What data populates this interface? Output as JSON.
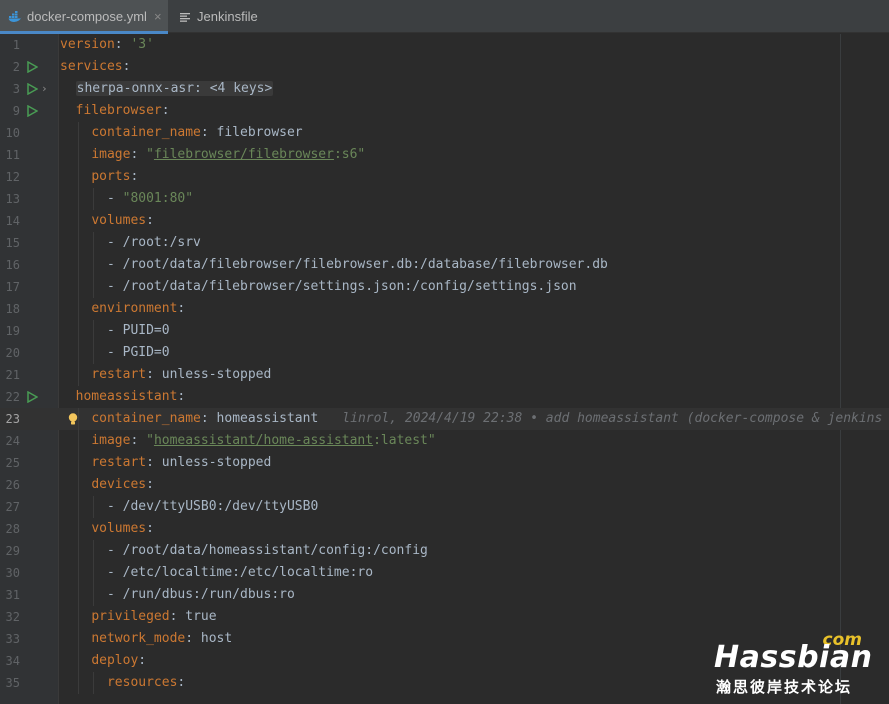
{
  "tabs": [
    {
      "label": "docker-compose.yml",
      "icon": "docker-icon",
      "active": true,
      "close": "×"
    },
    {
      "label": "Jenkinsfile",
      "icon": "text-file-icon",
      "active": false
    }
  ],
  "editor": {
    "current_line": "23",
    "blame": "linrol, 2024/4/19 22:38 • add homeassistant (docker-compose & jenkins",
    "lines": [
      {
        "n": "1",
        "run": false,
        "parts": [
          {
            "t": "version",
            "c": "k"
          },
          {
            "t": ": ",
            "c": "v"
          },
          {
            "t": "'3'",
            "c": "s"
          }
        ]
      },
      {
        "n": "2",
        "run": true,
        "parts": [
          {
            "t": "services",
            "c": "k"
          },
          {
            "t": ":",
            "c": "v"
          }
        ]
      },
      {
        "n": "3",
        "run": true,
        "fold": "›",
        "parts": [
          {
            "t": "  ",
            "c": "v"
          },
          {
            "t": "sherpa-onnx-asr: <4 keys>",
            "c": "folded"
          }
        ]
      },
      {
        "n": "9",
        "run": true,
        "parts": [
          {
            "t": "  ",
            "c": "v"
          },
          {
            "t": "filebrowser",
            "c": "k"
          },
          {
            "t": ":",
            "c": "v"
          }
        ]
      },
      {
        "n": "10",
        "run": false,
        "parts": [
          {
            "t": "    ",
            "c": "v"
          },
          {
            "t": "container_name",
            "c": "k"
          },
          {
            "t": ": filebrowser",
            "c": "v"
          }
        ]
      },
      {
        "n": "11",
        "run": false,
        "parts": [
          {
            "t": "    ",
            "c": "v"
          },
          {
            "t": "image",
            "c": "k"
          },
          {
            "t": ": ",
            "c": "v"
          },
          {
            "t": "\"",
            "c": "s"
          },
          {
            "t": "filebrowser/filebrowser",
            "c": "s u"
          },
          {
            "t": ":s6\"",
            "c": "s"
          }
        ]
      },
      {
        "n": "12",
        "run": false,
        "parts": [
          {
            "t": "    ",
            "c": "v"
          },
          {
            "t": "ports",
            "c": "k"
          },
          {
            "t": ":",
            "c": "v"
          }
        ]
      },
      {
        "n": "13",
        "run": false,
        "parts": [
          {
            "t": "      - ",
            "c": "v"
          },
          {
            "t": "\"8001:80\"",
            "c": "s"
          }
        ]
      },
      {
        "n": "14",
        "run": false,
        "parts": [
          {
            "t": "    ",
            "c": "v"
          },
          {
            "t": "volumes",
            "c": "k"
          },
          {
            "t": ":",
            "c": "v"
          }
        ]
      },
      {
        "n": "15",
        "run": false,
        "parts": [
          {
            "t": "      - /root:/srv",
            "c": "v"
          }
        ]
      },
      {
        "n": "16",
        "run": false,
        "parts": [
          {
            "t": "      - /root/data/filebrowser/filebrowser.db:/database/filebrowser.db",
            "c": "v"
          }
        ]
      },
      {
        "n": "17",
        "run": false,
        "parts": [
          {
            "t": "      - /root/data/filebrowser/settings.json:/config/settings.json",
            "c": "v"
          }
        ]
      },
      {
        "n": "18",
        "run": false,
        "parts": [
          {
            "t": "    ",
            "c": "v"
          },
          {
            "t": "environment",
            "c": "k"
          },
          {
            "t": ":",
            "c": "v"
          }
        ]
      },
      {
        "n": "19",
        "run": false,
        "parts": [
          {
            "t": "      - PUID=0",
            "c": "v"
          }
        ]
      },
      {
        "n": "20",
        "run": false,
        "parts": [
          {
            "t": "      - PGID=0",
            "c": "v"
          }
        ]
      },
      {
        "n": "21",
        "run": false,
        "parts": [
          {
            "t": "    ",
            "c": "v"
          },
          {
            "t": "restart",
            "c": "k"
          },
          {
            "t": ": unless-stopped",
            "c": "v"
          }
        ]
      },
      {
        "n": "22",
        "run": true,
        "parts": [
          {
            "t": "  ",
            "c": "v"
          },
          {
            "t": "homeassistant",
            "c": "k"
          },
          {
            "t": ":",
            "c": "v"
          }
        ]
      },
      {
        "n": "23",
        "run": false,
        "current": true,
        "bulb": true,
        "parts": [
          {
            "t": "    ",
            "c": "v"
          },
          {
            "t": "container_name",
            "c": "k"
          },
          {
            "t": ": homeassistant",
            "c": "v"
          }
        ]
      },
      {
        "n": "24",
        "run": false,
        "parts": [
          {
            "t": "    ",
            "c": "v"
          },
          {
            "t": "image",
            "c": "k"
          },
          {
            "t": ": ",
            "c": "v"
          },
          {
            "t": "\"",
            "c": "s"
          },
          {
            "t": "homeassistant/home-assistant",
            "c": "s u"
          },
          {
            "t": ":latest\"",
            "c": "s"
          }
        ]
      },
      {
        "n": "25",
        "run": false,
        "parts": [
          {
            "t": "    ",
            "c": "v"
          },
          {
            "t": "restart",
            "c": "k"
          },
          {
            "t": ": unless-stopped",
            "c": "v"
          }
        ]
      },
      {
        "n": "26",
        "run": false,
        "parts": [
          {
            "t": "    ",
            "c": "v"
          },
          {
            "t": "devices",
            "c": "k"
          },
          {
            "t": ":",
            "c": "v"
          }
        ]
      },
      {
        "n": "27",
        "run": false,
        "parts": [
          {
            "t": "      - /dev/ttyUSB0:/dev/ttyUSB0",
            "c": "v"
          }
        ]
      },
      {
        "n": "28",
        "run": false,
        "parts": [
          {
            "t": "    ",
            "c": "v"
          },
          {
            "t": "volumes",
            "c": "k"
          },
          {
            "t": ":",
            "c": "v"
          }
        ]
      },
      {
        "n": "29",
        "run": false,
        "parts": [
          {
            "t": "      - /root/data/homeassistant/config:/config",
            "c": "v"
          }
        ]
      },
      {
        "n": "30",
        "run": false,
        "parts": [
          {
            "t": "      - /etc/localtime:/etc/localtime:ro",
            "c": "v"
          }
        ]
      },
      {
        "n": "31",
        "run": false,
        "parts": [
          {
            "t": "      - /run/dbus:/run/dbus:ro",
            "c": "v"
          }
        ]
      },
      {
        "n": "32",
        "run": false,
        "parts": [
          {
            "t": "    ",
            "c": "v"
          },
          {
            "t": "privileged",
            "c": "k"
          },
          {
            "t": ": true",
            "c": "v"
          }
        ]
      },
      {
        "n": "33",
        "run": false,
        "parts": [
          {
            "t": "    ",
            "c": "v"
          },
          {
            "t": "network_mode",
            "c": "k"
          },
          {
            "t": ": host",
            "c": "v"
          }
        ]
      },
      {
        "n": "34",
        "run": false,
        "parts": [
          {
            "t": "    ",
            "c": "v"
          },
          {
            "t": "deploy",
            "c": "k"
          },
          {
            "t": ":",
            "c": "v"
          }
        ]
      },
      {
        "n": "35",
        "run": false,
        "parts": [
          {
            "t": "      ",
            "c": "v"
          },
          {
            "t": "resources",
            "c": "k"
          },
          {
            "t": ":",
            "c": "v"
          }
        ]
      }
    ]
  },
  "watermark": {
    "com": "com",
    "name": "Hassbian",
    "sub": "瀚思彼岸技术论坛"
  },
  "colors": {
    "keyword": "#cc7832",
    "string": "#6a8759",
    "text": "#a9b7c6",
    "run_icon": "#499c54",
    "bulb": "#f2c55c"
  }
}
